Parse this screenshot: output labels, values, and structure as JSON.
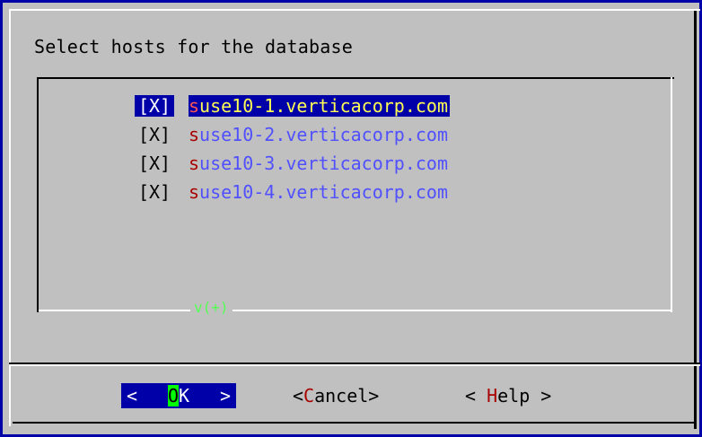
{
  "dialog": {
    "title": "Select hosts for the database"
  },
  "hosts": [
    {
      "check": "[X]",
      "hot": "s",
      "rest": "use10-1.verticacorp.com",
      "selected": true
    },
    {
      "check": "[X]",
      "hot": "s",
      "rest": "use10-2.verticacorp.com",
      "selected": false
    },
    {
      "check": "[X]",
      "hot": "s",
      "rest": "use10-3.verticacorp.com",
      "selected": false
    },
    {
      "check": "[X]",
      "hot": "s",
      "rest": "use10-4.verticacorp.com",
      "selected": false
    }
  ],
  "scroll_indicator": "v(+)",
  "buttons": {
    "ok": {
      "left": "<",
      "hot": "O",
      "rest": "K",
      "right": ">"
    },
    "cancel": {
      "prefix": "<",
      "hot": "C",
      "rest": "ancel>"
    },
    "help": {
      "prefix": "< ",
      "hot": "H",
      "rest": "elp >"
    }
  },
  "colors": {
    "background": "#0000a8",
    "dialog": "#c0c0c0",
    "highlight": "#0000a8",
    "hotkey": "#a80000",
    "host_text": "#5050ff",
    "selected_text": "#ffff54",
    "ok_hotkey_bg": "#00ff00",
    "scroll_indicator": "#54ff54"
  }
}
